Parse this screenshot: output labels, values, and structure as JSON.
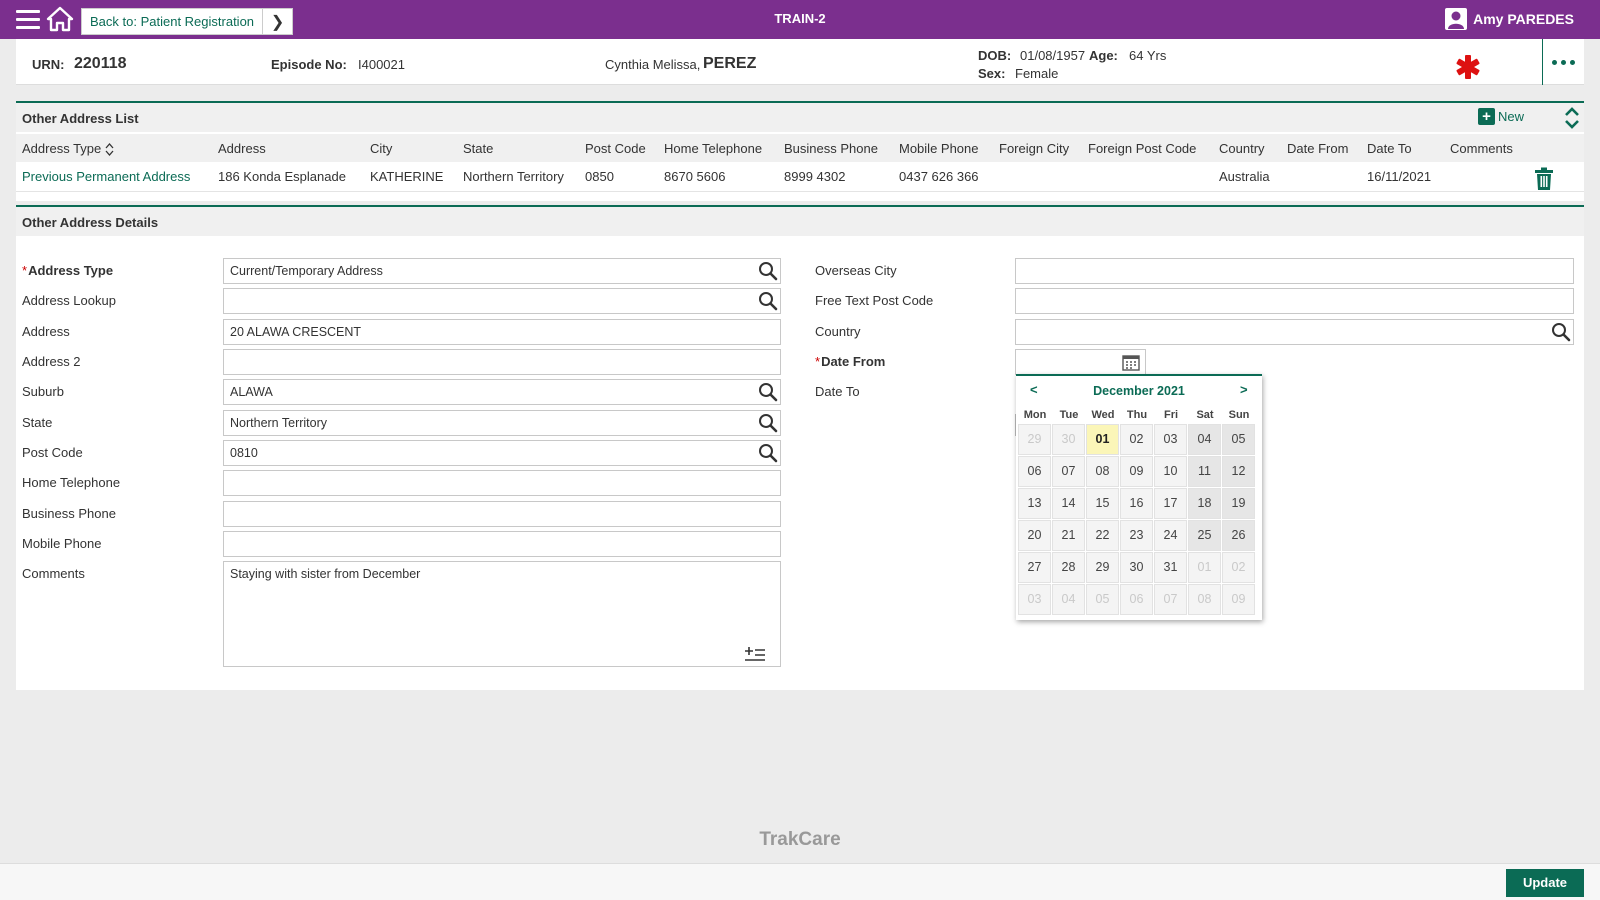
{
  "topbar": {
    "back_label": "Back to: Patient Registration",
    "environment": "TRAIN-2",
    "user_name": "Amy PAREDES"
  },
  "banner": {
    "urn_label": "URN:",
    "urn_value": "220118",
    "episode_label": "Episode No:",
    "episode_value": "I400021",
    "patient_given": "Cynthia Melissa,",
    "patient_family": "PEREZ",
    "dob_label": "DOB:",
    "dob_value": "01/08/1957",
    "age_label": "Age:",
    "age_value": "64 Yrs",
    "sex_label": "Sex:",
    "sex_value": "Female"
  },
  "address_list": {
    "title": "Other Address List",
    "new_label": "New",
    "columns": [
      "Address Type",
      "Address",
      "City",
      "State",
      "Post Code",
      "Home Telephone",
      "Business Phone",
      "Mobile Phone",
      "Foreign City",
      "Foreign Post Code",
      "Country",
      "Date From",
      "Date To",
      "Comments"
    ],
    "rows": [
      {
        "address_type": "Previous Permanent Address",
        "address": "186 Konda Esplanade",
        "city": "KATHERINE",
        "state": "Northern Territory",
        "post_code": "0850",
        "home_telephone": "8670 5606",
        "business_phone": "8999 4302",
        "mobile_phone": "0437 626 366",
        "foreign_city": "",
        "foreign_post_code": "",
        "country": "Australia",
        "date_from": "",
        "date_to": "16/11/2021",
        "comments": ""
      }
    ]
  },
  "details": {
    "title": "Other Address Details",
    "labels": {
      "address_type": "Address Type",
      "address_lookup": "Address Lookup",
      "address": "Address",
      "address2": "Address 2",
      "suburb": "Suburb",
      "state": "State",
      "post_code": "Post Code",
      "home_telephone": "Home Telephone",
      "business_phone": "Business Phone",
      "mobile_phone": "Mobile Phone",
      "comments": "Comments",
      "overseas_city": "Overseas City",
      "free_text_post_code": "Free Text Post Code",
      "country": "Country",
      "date_from": "Date From",
      "date_to": "Date To"
    },
    "values": {
      "address_type": "Current/Temporary Address",
      "address_lookup": "",
      "address": "20 ALAWA CRESCENT",
      "address2": "",
      "suburb": "ALAWA",
      "state": "Northern Territory",
      "post_code": "0810",
      "home_telephone": "",
      "business_phone": "",
      "mobile_phone": "",
      "comments": "Staying with sister from December",
      "overseas_city": "",
      "free_text_post_code": "",
      "country": "",
      "date_from": ""
    }
  },
  "calendar": {
    "prev": "<",
    "next": ">",
    "month_title": "December 2021",
    "weekdays": [
      "Mon",
      "Tue",
      "Wed",
      "Thu",
      "Fri",
      "Sat",
      "Sun"
    ],
    "days": [
      [
        "29",
        "30",
        "01",
        "02",
        "03",
        "04",
        "05"
      ],
      [
        "06",
        "07",
        "08",
        "09",
        "10",
        "11",
        "12"
      ],
      [
        "13",
        "14",
        "15",
        "16",
        "17",
        "18",
        "19"
      ],
      [
        "20",
        "21",
        "22",
        "23",
        "24",
        "25",
        "26"
      ],
      [
        "27",
        "28",
        "29",
        "30",
        "31",
        "01",
        "02"
      ],
      [
        "03",
        "04",
        "05",
        "06",
        "07",
        "08",
        "09"
      ]
    ],
    "today": "01"
  },
  "footer": {
    "brand": "TrakCare",
    "update_label": "Update"
  },
  "colors": {
    "header_purple": "#7b2f8e",
    "accent_teal": "#0b6b55",
    "today_highlight": "#fbf6b8",
    "required_red": "#cc0000"
  },
  "icons": [
    "hamburger-icon",
    "home-icon",
    "chevron-right-icon",
    "user-icon",
    "medical-star-icon",
    "more-options-icon",
    "plus-icon",
    "collapse-icon",
    "sort-icon",
    "trash-icon",
    "search-icon",
    "calendar-icon",
    "expand-text-icon"
  ]
}
